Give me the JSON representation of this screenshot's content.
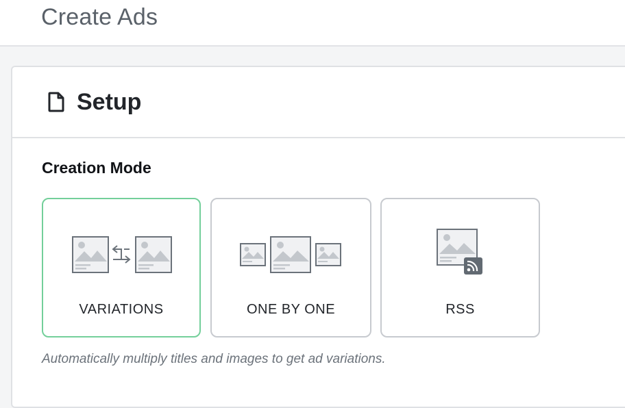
{
  "page": {
    "title": "Create Ads"
  },
  "card": {
    "title": "Setup",
    "title_icon": "document-icon",
    "section_label": "Creation Mode",
    "modes": [
      {
        "label": "VARIATIONS",
        "icon": "variations-illustration",
        "selected": true
      },
      {
        "label": "ONE BY ONE",
        "icon": "one-by-one-illustration",
        "selected": false
      },
      {
        "label": "RSS",
        "icon": "rss-illustration",
        "selected": false
      }
    ],
    "hint": "Automatically multiply titles and images to get ad variations."
  },
  "colors": {
    "selected_border": "#73cf9a",
    "border": "#c7cacf",
    "text": "#22252a"
  }
}
